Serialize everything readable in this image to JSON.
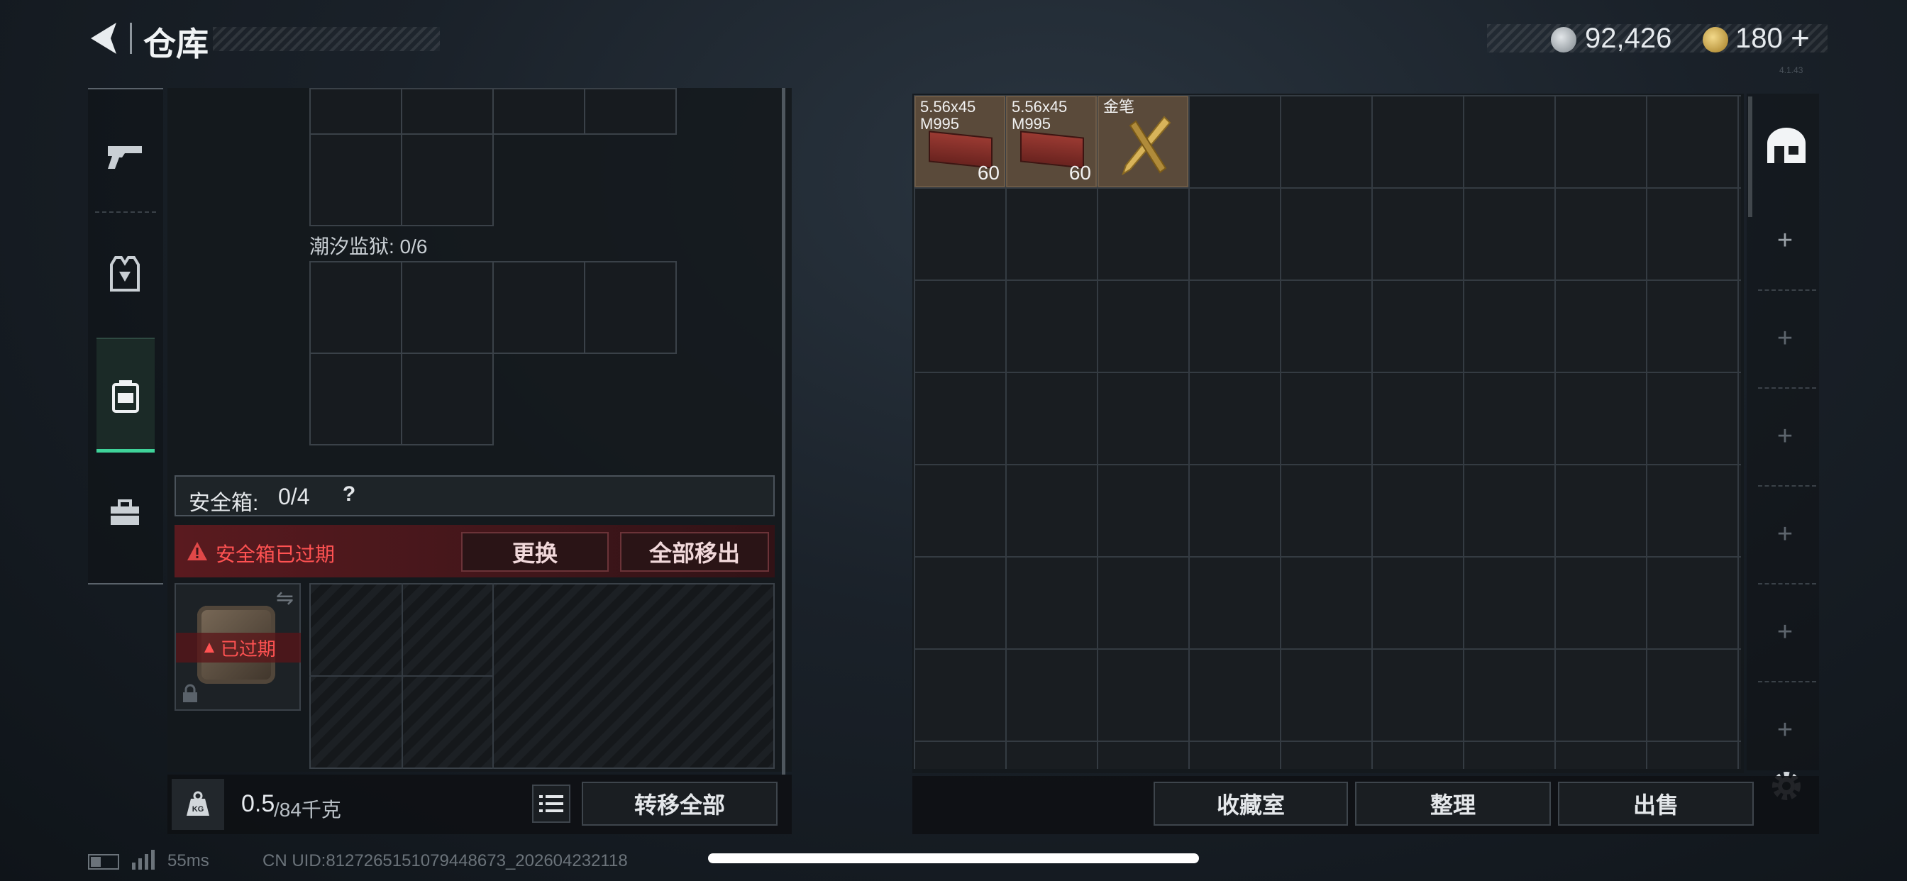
{
  "header": {
    "title": "仓库",
    "currency1": "92,426",
    "currency2": "180",
    "currency2_add": "+",
    "version": "4.1.43"
  },
  "left_tabs": [
    "weapon-tab",
    "armor-tab",
    "backpack-tab",
    "toolbox-tab"
  ],
  "container": {
    "section_label": "潮汐监狱: 0/6",
    "safebox_label": "安全箱:",
    "safebox_count": "0/4",
    "safebox_help": "?",
    "expired_warning": "安全箱已过期",
    "replace_button": "更换",
    "remove_all_button": "全部移出",
    "safebox_expired_badge": "已过期",
    "weight_value": "0.5",
    "weight_max": "/84千克",
    "weight_icon_label": "KG",
    "transfer_all_button": "转移全部"
  },
  "storage": {
    "items": [
      {
        "name": "5.56x45\nM995",
        "count": "60"
      },
      {
        "name": "5.56x45\nM995",
        "count": "60"
      },
      {
        "name": "金笔",
        "count": ""
      }
    ],
    "collection_button": "收藏室",
    "organize_button": "整理",
    "sell_button": "出售",
    "add_pages": [
      "+",
      "+",
      "+",
      "+",
      "+",
      "+"
    ]
  },
  "status": {
    "ping": "55ms",
    "uid": "CN UID:8127265151079448673_202604232118"
  },
  "colors": {
    "accent_green": "#3fd39a",
    "warning_red": "#e04848",
    "item_bg": "#5a4a3a"
  }
}
